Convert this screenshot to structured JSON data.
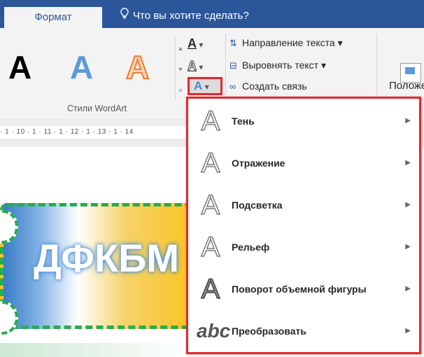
{
  "ribbon": {
    "active_tab": "Формат",
    "tell_me": "Что вы хотите сделать?",
    "wordart_letter": "A",
    "gallery_label": "Стили WordArt",
    "fill_button_glyph": "A",
    "outline_button_glyph": "A",
    "effects_button_glyph": "A",
    "dropdown_glyph": "▾",
    "text_direction": "Направление текста",
    "align_text": "Выровнять текст",
    "create_link": "Создать связь",
    "position": "Положе"
  },
  "ruler": {
    "text": "· 1 · 10 · 1 · 11 · 1 · 12 · 1 · 13 · 1 · 14"
  },
  "document": {
    "wordart_text": "ДФКБМ"
  },
  "menu": {
    "items": [
      {
        "label": "Тень",
        "icon": "A",
        "icon_name": "shadow"
      },
      {
        "label": "Отражение",
        "icon": "A",
        "icon_name": "reflection"
      },
      {
        "label": "Подсветка",
        "icon": "A",
        "icon_name": "glow"
      },
      {
        "label": "Рельеф",
        "icon": "A",
        "icon_name": "bevel"
      },
      {
        "label": "Поворот объемной фигуры",
        "icon": "A",
        "icon_name": "3d-rotation"
      },
      {
        "label": "Преобразовать",
        "icon": "abc",
        "icon_name": "transform"
      }
    ],
    "arrow": "▶"
  },
  "colors": {
    "tab_bar": "#2b579a",
    "highlight_border": "#e8262c",
    "dash_green": "#27ad4a"
  }
}
